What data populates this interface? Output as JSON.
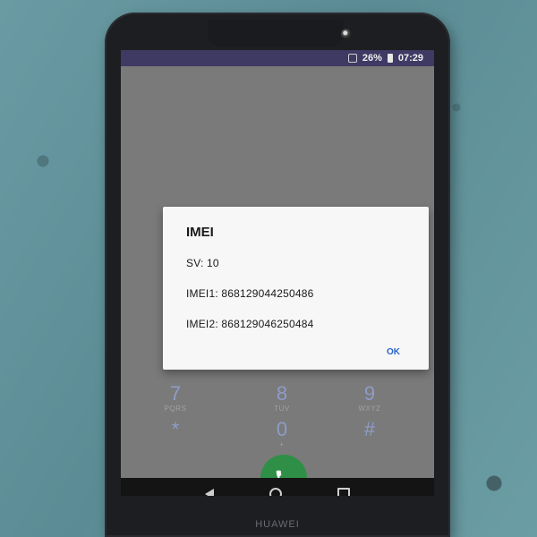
{
  "status_bar": {
    "battery": "26%",
    "time": "07:29"
  },
  "dialog": {
    "title": "IMEI",
    "sv": "SV: 10",
    "imei1": "IMEI1: 868129044250486",
    "imei2": "IMEI2: 868129046250484",
    "ok_label": "OK"
  },
  "dialer": {
    "keys": [
      {
        "digit": "7",
        "letters": "PQRS"
      },
      {
        "digit": "8",
        "letters": "TUV"
      },
      {
        "digit": "9",
        "letters": "WXYZ"
      },
      {
        "digit": "*",
        "letters": ""
      },
      {
        "digit": "0",
        "letters": "+"
      },
      {
        "digit": "#",
        "letters": ""
      }
    ]
  },
  "brand": "HUAWEI",
  "icons": [
    "sim-icon",
    "battery-icon",
    "call-icon",
    "back-icon",
    "home-icon",
    "recents-icon"
  ]
}
